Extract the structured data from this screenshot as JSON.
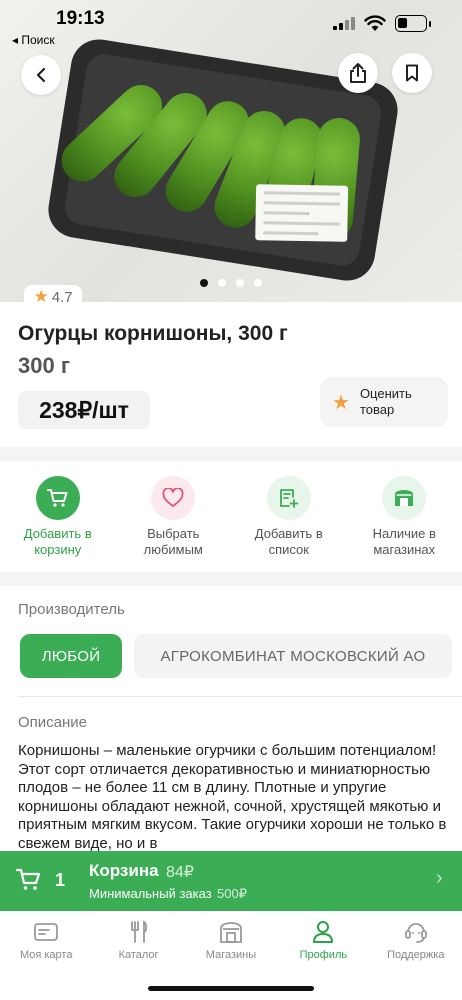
{
  "status_bar": {
    "time": "19:13",
    "back_app": "◂ Поиск"
  },
  "product": {
    "rating": "4.7",
    "title": "Огурцы корнишоны, 300 г",
    "weight": "300 г",
    "price": "238₽/шт",
    "rate_button": "Оценить товар"
  },
  "actions": [
    {
      "label": "Добавить в корзину",
      "icon": "cart-icon"
    },
    {
      "label": "Выбрать любимым",
      "icon": "heart-icon"
    },
    {
      "label": "Добавить в список",
      "icon": "list-add-icon"
    },
    {
      "label": "Наличие в магазинах",
      "icon": "store-icon"
    }
  ],
  "manufacturer": {
    "label": "Производитель",
    "options": [
      "ЛЮБОЙ",
      "АГРОКОМБИНАТ МОСКОВСКИЙ АО"
    ],
    "selected": "ЛЮБОЙ"
  },
  "description": {
    "label": "Описание",
    "text": "Корнишоны – маленькие огурчики с большим потенциалом! Этот сорт отличается декоративностью и миниатюрностью плодов – не более 11 см в длину. Плотные и упругие корнишоны обладают нежной, сочной, хрустящей мякотью и приятным мягким вкусом. Такие огурчики хороши не только в свежем виде, но и в"
  },
  "cart": {
    "count": "1",
    "title": "Корзина",
    "sum": "84₽",
    "min_label": "Минимальный заказ",
    "min_value": "500₽"
  },
  "tabs": [
    {
      "label": "Моя карта",
      "icon": "card-icon"
    },
    {
      "label": "Каталог",
      "icon": "fork-knife-icon"
    },
    {
      "label": "Магазины",
      "icon": "store-icon"
    },
    {
      "label": "Профиль",
      "icon": "user-icon",
      "active": true
    },
    {
      "label": "Поддержка",
      "icon": "support-icon"
    }
  ],
  "colors": {
    "accent": "#3bad55",
    "star": "#f0a041",
    "text": "#222222"
  }
}
